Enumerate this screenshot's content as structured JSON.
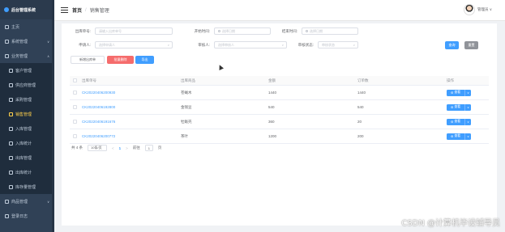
{
  "sidebar": {
    "logo": "后台管理系统",
    "items": [
      {
        "label": "主页",
        "icon": "home-icon"
      },
      {
        "label": "系统管理",
        "icon": "gear-icon",
        "arrow": "∨"
      },
      {
        "label": "业务管理",
        "icon": "grid-icon",
        "arrow": "∧"
      }
    ],
    "sub_items": [
      {
        "label": "客户管理"
      },
      {
        "label": "供应商管理"
      },
      {
        "label": "采购管理"
      },
      {
        "label": "销售管理",
        "active": true
      },
      {
        "label": "入库管理"
      },
      {
        "label": "入库统计"
      },
      {
        "label": "出库管理"
      },
      {
        "label": "出库统计"
      },
      {
        "label": "库存量管理"
      }
    ],
    "bottom_items": [
      {
        "label": "商品管理",
        "arrow": "∨"
      },
      {
        "label": "登录日志"
      }
    ]
  },
  "header": {
    "breadcrumb_home": "首页",
    "breadcrumb_sep": "/",
    "breadcrumb_current": "销售管理",
    "user_name": "管理员 ∨"
  },
  "search": {
    "order_no_label": "出库单号:",
    "order_no_placeholder": "请输入出库单号",
    "start_label": "开始时间:",
    "start_placeholder": "选择日期",
    "end_label": "结束时间:",
    "end_placeholder": "选择日期",
    "applicant_label": "申请人:",
    "applicant_placeholder": "选择申请人",
    "reviewer_label": "审核人:",
    "reviewer_placeholder": "选择审核人",
    "status_label": "审核状态:",
    "status_placeholder": "审核状态",
    "query_button": "查询",
    "reset_button": "重置"
  },
  "actions": {
    "add_button": "新增出库单",
    "batch_delete_button": "批量删除",
    "export_button": "导出"
  },
  "table": {
    "headers": [
      "出库单号",
      "出库商品",
      "金额",
      "订单数",
      "操作"
    ],
    "rows": [
      {
        "order_no": "CK20220406200930",
        "product": "苍蝇木",
        "amount": "1440",
        "count": "1440"
      },
      {
        "order_no": "CK20220406192800",
        "product": "金钱豆",
        "amount": "540",
        "count": "540"
      },
      {
        "order_no": "CK20220406191676",
        "product": "牡蛎壳",
        "amount": "360",
        "count": "20"
      },
      {
        "order_no": "CK20220406200772",
        "product": "茶叶",
        "amount": "1200",
        "count": "200"
      }
    ],
    "op_label": "查看",
    "op_dropdown": "∨"
  },
  "pagination": {
    "total": "共 4 条",
    "page_size": "10条/页",
    "prev": "<",
    "page": "1",
    "next": ">",
    "goto_label": "前往",
    "goto_value": "1",
    "goto_suffix": "页"
  },
  "watermark": "CSDN @计算机毕设辅导员",
  "colors": {
    "sidebar_bg": "#304156",
    "primary": "#409eff",
    "danger": "#f56c6c",
    "active": "#ffd04b"
  }
}
